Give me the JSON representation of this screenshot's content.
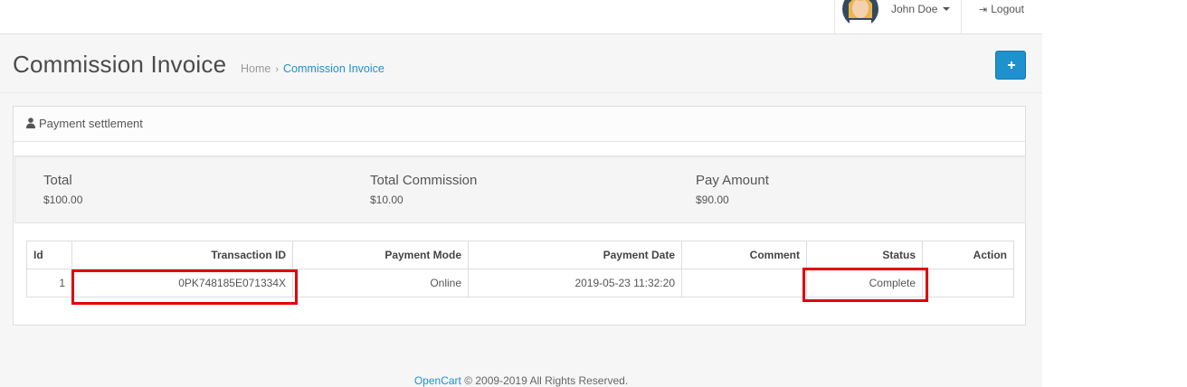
{
  "header": {
    "user_name": "John Doe",
    "logout_label": "Logout"
  },
  "page": {
    "title": "Commission Invoice",
    "breadcrumb": [
      {
        "label": "Home"
      },
      {
        "label": "Commission Invoice"
      }
    ],
    "breadcrumb_separator": "›"
  },
  "panel": {
    "title": "Payment settlement",
    "summary": [
      {
        "label": "Total",
        "value": "$100.00"
      },
      {
        "label": "Total Commission",
        "value": "$10.00"
      },
      {
        "label": "Pay Amount",
        "value": "$90.00"
      }
    ]
  },
  "table": {
    "columns": [
      "Id",
      "Transaction ID",
      "Payment Mode",
      "Payment Date",
      "Comment",
      "Status",
      "Action"
    ],
    "rows": [
      {
        "id": "1",
        "transaction_id": "0PK748185E071334X",
        "payment_mode": "Online",
        "payment_date": "2019-05-23 11:32:20",
        "comment": "",
        "status": "Complete",
        "action": ""
      }
    ]
  },
  "footer": {
    "link_text": "OpenCart",
    "text": " © 2009-2019 All Rights Reserved."
  },
  "colors": {
    "primary": "#1e91cf",
    "highlight": "#e00000",
    "background": "#f6f6f6"
  },
  "icons": {
    "avatar": "user-avatar",
    "user_menu_caret": "caret-down-icon",
    "logout": "sign-out-icon",
    "add": "plus-icon",
    "panel_heading": "user-icon"
  }
}
